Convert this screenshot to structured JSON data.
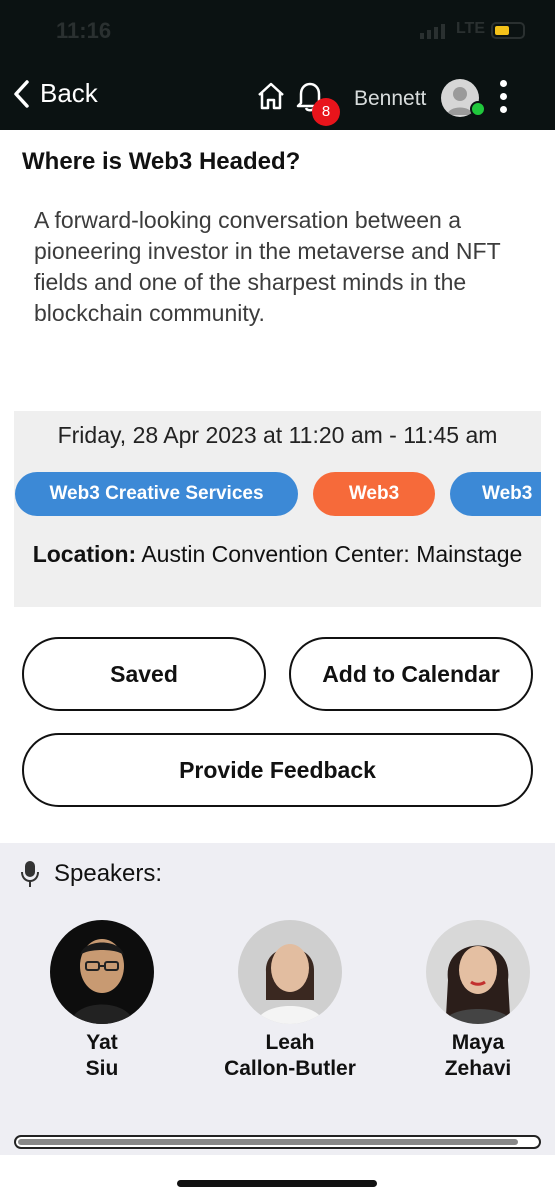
{
  "status_bar": {
    "time": "11:16",
    "network": "LTE"
  },
  "nav": {
    "back_label": "Back",
    "home_icon": "home-icon",
    "notification_icon": "bell-icon",
    "notification_count": "8",
    "username": "Bennett",
    "menu_icon": "more-vertical-icon"
  },
  "session": {
    "title": "Where is Web3 Headed?",
    "description": "A forward-looking conversation between a pioneering investor in the metaverse and NFT fields and one of the sharpest minds in the blockchain community.",
    "datetime": "Friday, 28 Apr 2023 at 11:20 am - 11:45 am",
    "tags": [
      {
        "label": "Web3 Creative Services",
        "color": "#3c89d6"
      },
      {
        "label": "Web3",
        "color": "#f66a3a"
      },
      {
        "label": "Web3",
        "color": "#3c89d6"
      }
    ],
    "location_label": "Location:",
    "location_value": "Austin Convention Center: Mainstage"
  },
  "actions": {
    "saved_label": "Saved",
    "calendar_label": "Add to Calendar",
    "feedback_label": "Provide Feedback"
  },
  "speakers": {
    "heading": "Speakers:",
    "icon": "microphone-icon",
    "list": [
      {
        "first": "Yat",
        "last": "Siu"
      },
      {
        "first": "Leah",
        "last": "Callon-Butler"
      },
      {
        "first": "Maya",
        "last": "Zehavi"
      }
    ]
  },
  "colors": {
    "bar_bg": "#0b1212",
    "badge": "#e8141b",
    "online": "#20c83c",
    "tag_blue": "#3c89d6",
    "tag_orange": "#f66a3a"
  }
}
